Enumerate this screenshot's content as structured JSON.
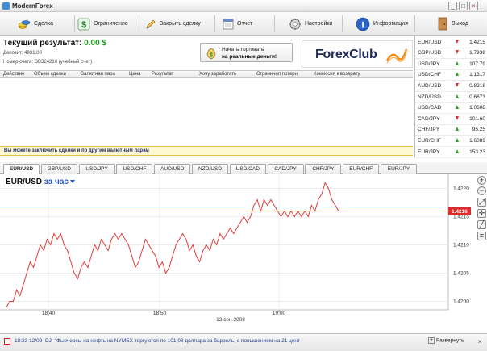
{
  "app": {
    "title": "ModernForex"
  },
  "window_buttons": {
    "minimize": "_",
    "maximize": "□",
    "close": "×"
  },
  "toolbar": {
    "items": [
      {
        "label": "Сделка",
        "icon": "coins-icon"
      },
      {
        "label": "Ограничение",
        "icon": "dollar-limit-icon"
      },
      {
        "label": "Закрыть сделку",
        "icon": "pencil-icon"
      },
      {
        "label": "Отчет",
        "icon": "calendar-report-icon"
      },
      {
        "label": "Настройки",
        "icon": "gear-icon"
      },
      {
        "label": "Информация",
        "icon": "info-icon"
      },
      {
        "label": "Выход",
        "icon": "exit-door-icon"
      }
    ]
  },
  "account": {
    "result_label": "Текущий результат:",
    "result_value": "0.00 $",
    "deposit": "Депозит: 4931.00",
    "account_number": "Номер счета: DB324210 (учебный счет)"
  },
  "real_trade": {
    "line1": "Начать торговать",
    "line2": "на реальные деньги!"
  },
  "logo": {
    "text": "ForexClub"
  },
  "deals_table": {
    "columns": [
      "Действие",
      "Объем сделки",
      "Валютная пара",
      "Цена",
      "Результат",
      "Хочу заработать",
      "Ограничил потери",
      "Комиссия к возврату"
    ],
    "rows": []
  },
  "info_bar": {
    "text": "Вы можете заключить сделки и по другим валютным парам"
  },
  "quotes": [
    {
      "pair": "EUR/USD",
      "direction": "down",
      "price": "1.4215"
    },
    {
      "pair": "GBP/USD",
      "direction": "down",
      "price": "1.7938"
    },
    {
      "pair": "USD/JPY",
      "direction": "up",
      "price": "107.79"
    },
    {
      "pair": "USD/CHF",
      "direction": "up",
      "price": "1.1317"
    },
    {
      "pair": "AUD/USD",
      "direction": "down",
      "price": "0.8218"
    },
    {
      "pair": "NZD/USD",
      "direction": "up",
      "price": "0.6673"
    },
    {
      "pair": "USD/CAD",
      "direction": "up",
      "price": "1.0608"
    },
    {
      "pair": "CAD/JPY",
      "direction": "down",
      "price": "101.60"
    },
    {
      "pair": "CHF/JPY",
      "direction": "up",
      "price": "95.25"
    },
    {
      "pair": "EUR/CHF",
      "direction": "up",
      "price": "1.6089"
    },
    {
      "pair": "EUR/JPY",
      "direction": "up",
      "price": "153.23"
    }
  ],
  "currency_tabs": {
    "active": "EUR/USD",
    "items": [
      "EUR/USD",
      "GBP/USD",
      "USD/JPY",
      "USD/CHF",
      "AUD/USD",
      "NZD/USD",
      "USD/CAD",
      "CAD/JPY",
      "CHF/JPY",
      "EUR/CHF",
      "EUR/JPY"
    ]
  },
  "chart_header": {
    "pair": "EUR/USD",
    "period": "за час"
  },
  "colors": {
    "line": "#e03c3c",
    "current_price_bg": "#e02a2a",
    "up": "#2aa02a",
    "down": "#d83030"
  },
  "chart_data": {
    "type": "line",
    "title": "EUR/USD за час",
    "date_label": "12 сен 2008",
    "x_ticks": [
      "18:40",
      "18:50",
      "19:00"
    ],
    "y_ticks": [
      "1.4220",
      "1.4215",
      "1.4210",
      "1.4205",
      "1.4200"
    ],
    "ylim": [
      1.41985,
      1.42225
    ],
    "current_price": "1.4216",
    "grid": true,
    "series": [
      {
        "values": [
          1.4199,
          1.42,
          1.42,
          1.4202,
          1.4201,
          1.4203,
          1.4205,
          1.4207,
          1.4206,
          1.4208,
          1.421,
          1.4209,
          1.4211,
          1.421,
          1.4212,
          1.4211,
          1.4212,
          1.421,
          1.4209,
          1.4207,
          1.4205,
          1.4204,
          1.4206,
          1.4207,
          1.4206,
          1.4208,
          1.421,
          1.4209,
          1.4211,
          1.421,
          1.4209,
          1.4211,
          1.4212,
          1.4211,
          1.4212,
          1.4211,
          1.421,
          1.4208,
          1.4206,
          1.4207,
          1.4209,
          1.4211,
          1.421,
          1.4209,
          1.4208,
          1.4206,
          1.4207,
          1.4205,
          1.4206,
          1.4208,
          1.421,
          1.4211,
          1.4212,
          1.4211,
          1.4209,
          1.421,
          1.4208,
          1.4207,
          1.4209,
          1.421,
          1.4209,
          1.4211,
          1.421,
          1.4212,
          1.4211,
          1.4212,
          1.4213,
          1.4212,
          1.4213,
          1.4214,
          1.4215,
          1.4214,
          1.4215,
          1.4217,
          1.4218,
          1.4216,
          1.4218,
          1.4217,
          1.4218,
          1.4217,
          1.4216,
          1.4215,
          1.4216,
          1.4215,
          1.4216,
          1.4215,
          1.4216,
          1.4215,
          1.4216,
          1.4215,
          1.4217,
          1.4216,
          1.4218,
          1.4219,
          1.4221,
          1.422,
          1.4218,
          1.4217,
          1.4216
        ]
      }
    ]
  },
  "news": {
    "timestamp": "18:33 12/09",
    "text": "DJ: \"Фьючерсы на нефть на NYMEX торгуются по 101,08 доллара за баррель, с повышением на 21 цент",
    "expand_label": "Развернуть",
    "close_label": "×"
  }
}
